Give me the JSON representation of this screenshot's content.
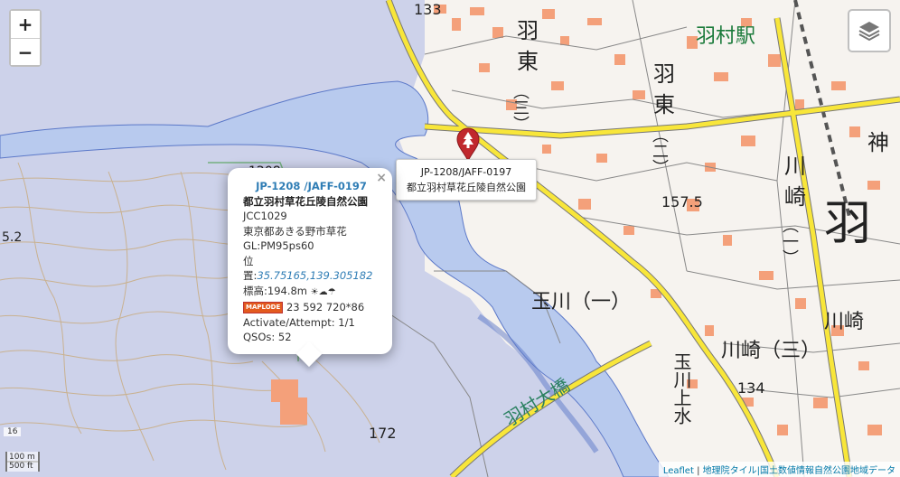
{
  "zoom": {
    "in_label": "+",
    "out_label": "−"
  },
  "popup": {
    "close": "×",
    "title": "JP-1208 /JAFF-0197",
    "name": "都立羽村草花丘陵自然公園",
    "jcc": "JCC1029",
    "address": "東京都あきる野市草花",
    "gl": "GL:PM95ps60",
    "position_label": "位置:",
    "position_value": "35.75165,139.305182",
    "elevation": "標高:194.8m",
    "weather_icon": "weather-icons",
    "maplode_logo": "MAPLODE",
    "maplode_value": "23 592 720*86",
    "activate": "Activate/Attempt: 1/1",
    "qsos": "QSOs: 52"
  },
  "tooltip": {
    "line1": "JP-1208/JAFF-0197",
    "line2": "都立羽村草花丘陵自然公園"
  },
  "map_labels": {
    "station": "羽村駅",
    "higashi3_a": "羽",
    "higashi3_b": "東",
    "higashi3_c": "（三）",
    "higashi2_a": "羽",
    "higashi2_b": "東",
    "higashi2_c": "（二）",
    "kawasaki_a": "川",
    "kawasaki_b": "崎",
    "kawasaki_c": "（一）",
    "big_ha": "羽",
    "kami": "神",
    "tamagawa": "玉川（一）",
    "kawasaki3": "川崎（三）",
    "kawasaki_r": "川崎",
    "bridge": "羽村大橋",
    "tamagawa_kamisui": "玉川上水",
    "elev_133": "133",
    "elev_1208": "1208",
    "elev_1575": "157.5",
    "elev_134": "134",
    "elev_172": "172",
    "elev_52": "5.2"
  },
  "scale": {
    "zoom_level": "16",
    "metric": "100 m",
    "imperial": "500 ft"
  },
  "attribution": {
    "leaflet": "Leaflet",
    "sep": " | ",
    "text": "地理院タイル|国土数値情報自然公園地域データ"
  },
  "colors": {
    "water": "#b7c9ee",
    "park": "#c9cfe8",
    "road_yellow": "#f8e63a",
    "building": "#f4a07a",
    "link": "#2f7db5",
    "marker": "#c0282d"
  }
}
